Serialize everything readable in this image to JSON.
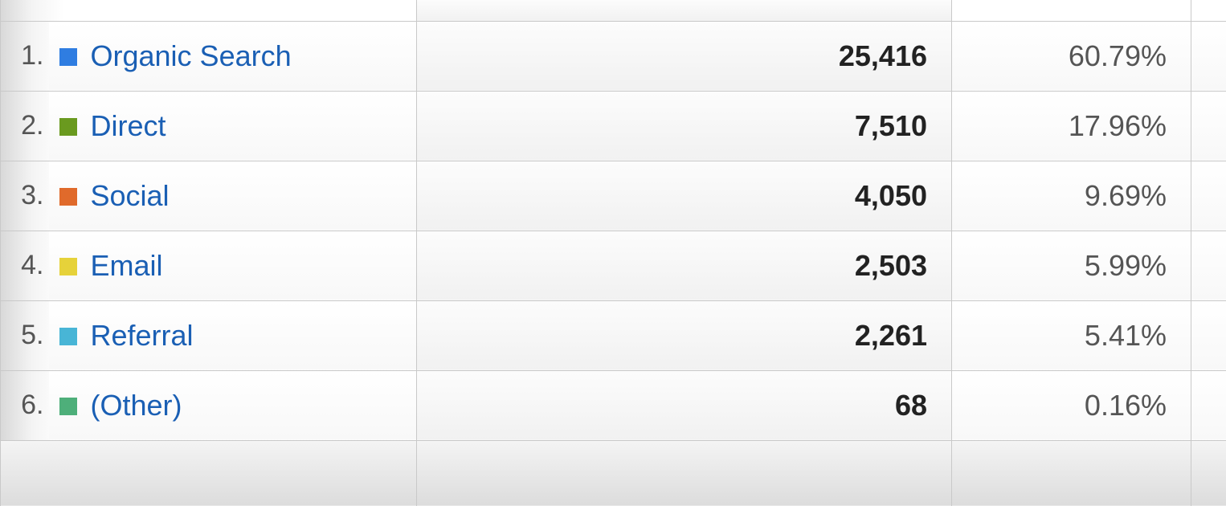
{
  "table": {
    "rows": [
      {
        "index": "1.",
        "color": "#2f7de1",
        "label": "Organic Search",
        "value": "25,416",
        "percent": "60.79%"
      },
      {
        "index": "2.",
        "color": "#6a9a1f",
        "label": "Direct",
        "value": "7,510",
        "percent": "17.96%"
      },
      {
        "index": "3.",
        "color": "#e06a2b",
        "label": "Social",
        "value": "4,050",
        "percent": "9.69%"
      },
      {
        "index": "4.",
        "color": "#e6d23a",
        "label": "Email",
        "value": "2,503",
        "percent": "5.99%"
      },
      {
        "index": "5.",
        "color": "#48b5d6",
        "label": "Referral",
        "value": "2,261",
        "percent": "5.41%"
      },
      {
        "index": "6.",
        "color": "#4eaf7a",
        "label": "(Other)",
        "value": "68",
        "percent": "0.16%"
      }
    ]
  }
}
